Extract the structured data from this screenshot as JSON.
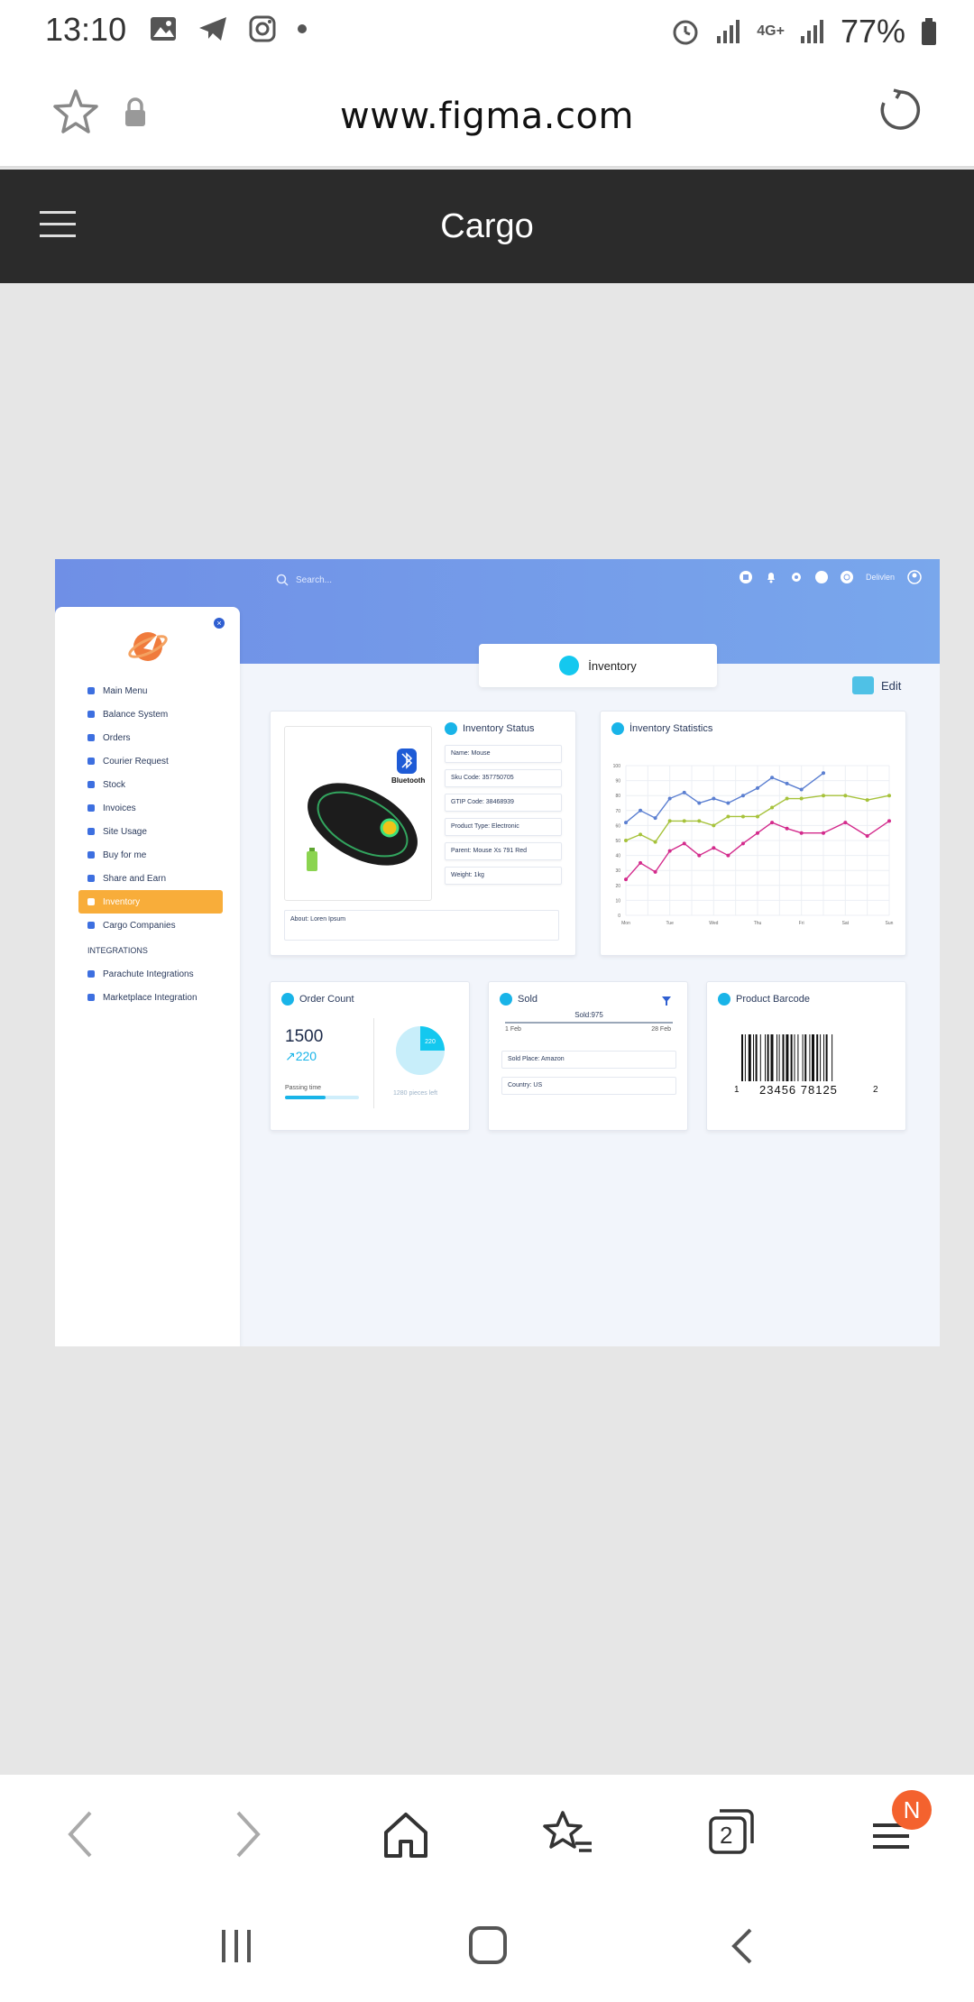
{
  "status_bar": {
    "time": "13:10",
    "battery": "77%",
    "network": "4G+"
  },
  "browser": {
    "url": "www.figma.com",
    "tabs_count": "2",
    "menu_badge": "N"
  },
  "app": {
    "title": "Cargo"
  },
  "dashboard": {
    "search_placeholder": "Search...",
    "user_name": "Delivlen",
    "page_title": "İnventory",
    "edit_label": "Edit",
    "sidebar": {
      "items": [
        "Main Menu",
        "Balance System",
        "Orders",
        "Courier Request",
        "Stock",
        "Invoices",
        "Site Usage",
        "Buy for me",
        "Share and Earn",
        "Inventory",
        "Cargo Companies"
      ],
      "section_label": "INTEGRATIONS",
      "integration_items": [
        "Parachute Integrations",
        "Marketplace Integration"
      ]
    },
    "inventory_status": {
      "title": "Inventory Status",
      "fields": [
        "Name: Mouse",
        "Sku Code: 357750705",
        "GTIP Code: 38468939",
        "Product Type: Electronic",
        "Parent: Mouse Xs 791 Red",
        "Weight: 1kg"
      ],
      "about": "About: Loren Ipsum",
      "image_badge": "Bluetooth"
    },
    "inventory_statistics": {
      "title": "İnventory Statistics"
    },
    "order_count": {
      "title": "Order Count",
      "total": "1500",
      "change": "220",
      "passing_label": "Passing time",
      "progress": 0.55,
      "pie_value": "220",
      "pieces_left": "1280 pieces left"
    },
    "sold": {
      "title": "Sold",
      "total_label": "Sold:975",
      "from": "1 Feb",
      "to": "28 Feb",
      "fields": [
        "Sold Place: Amazon",
        "Country: US"
      ]
    },
    "barcode": {
      "title": "Product Barcode",
      "first_digit": "1",
      "digits": "23456 78125",
      "last_digit": "2"
    }
  },
  "chart_data": {
    "type": "line",
    "categories": [
      "Mon",
      "Tue",
      "Wed",
      "Thu",
      "Fri",
      "Sat",
      "Sun"
    ],
    "ylim": [
      0,
      100
    ],
    "yticks": [
      0,
      10,
      20,
      30,
      40,
      50,
      60,
      70,
      80,
      90,
      100
    ],
    "grid": true,
    "x": [
      0,
      0.33,
      0.67,
      1,
      1.33,
      1.67,
      2,
      2.33,
      2.67,
      3,
      3.33,
      3.67,
      4,
      4.5,
      5,
      5.5,
      6
    ],
    "series": [
      {
        "color": "#5b7fd1",
        "values": [
          62,
          70,
          65,
          78,
          82,
          75,
          78,
          75,
          80,
          85,
          92,
          88,
          84,
          95,
          null,
          null,
          null
        ]
      },
      {
        "color": "#a6c23a",
        "values": [
          50,
          54,
          49,
          63,
          63,
          63,
          60,
          66,
          66,
          66,
          72,
          78,
          78,
          80,
          80,
          77,
          80
        ]
      },
      {
        "color": "#d32b8c",
        "values": [
          24,
          35,
          29,
          43,
          48,
          40,
          45,
          40,
          48,
          55,
          62,
          58,
          55,
          55,
          62,
          53,
          63
        ]
      }
    ]
  }
}
